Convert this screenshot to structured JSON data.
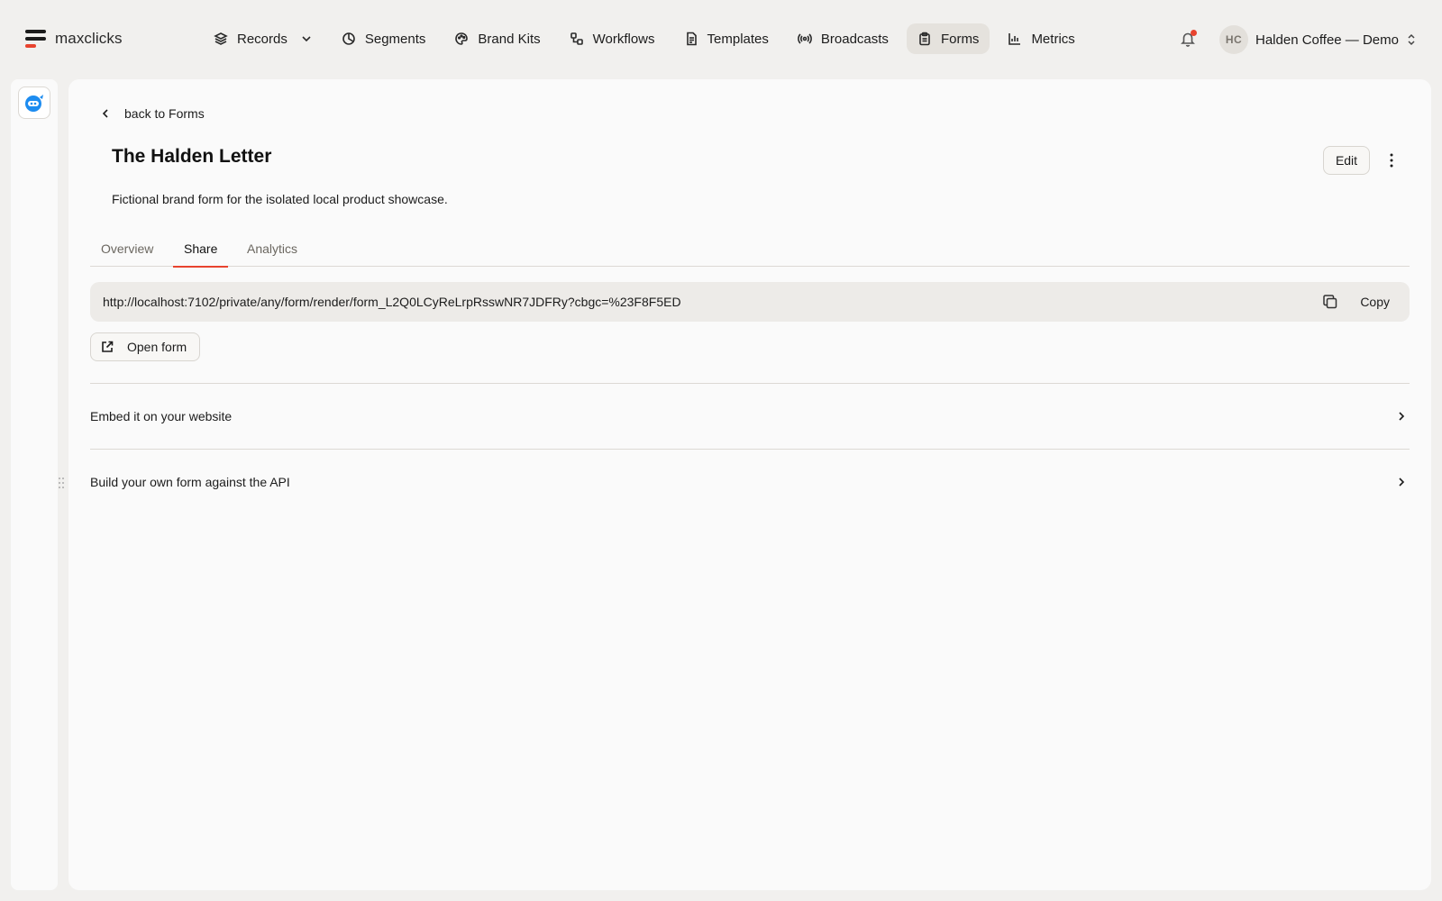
{
  "brand": {
    "name": "maxclicks",
    "accent": "#e8432e"
  },
  "nav": {
    "items": [
      {
        "label": "Records",
        "icon": "layers-icon"
      },
      {
        "label": "Segments",
        "icon": "pie-icon"
      },
      {
        "label": "Brand Kits",
        "icon": "palette-icon"
      },
      {
        "label": "Workflows",
        "icon": "workflow-icon"
      },
      {
        "label": "Templates",
        "icon": "document-icon"
      },
      {
        "label": "Broadcasts",
        "icon": "broadcast-icon"
      },
      {
        "label": "Forms",
        "icon": "clipboard-icon",
        "active": true
      },
      {
        "label": "Metrics",
        "icon": "bar-chart-icon"
      }
    ]
  },
  "account": {
    "initials": "HC",
    "name": "Halden Coffee — Demo"
  },
  "page": {
    "back_label": "back to Forms",
    "title": "The Halden Letter",
    "description": "Fictional brand form for the isolated local product showcase.",
    "edit_label": "Edit",
    "tabs": [
      {
        "label": "Overview"
      },
      {
        "label": "Share",
        "active": true
      },
      {
        "label": "Analytics"
      }
    ]
  },
  "share": {
    "url": "http://localhost:7102/private/any/form/render/form_L2Q0LCyReLrpRsswNR7JDFRy?cbgc=%23F8F5ED",
    "copy_label": "Copy",
    "open_label": "Open form",
    "sections": [
      {
        "label": "Embed it on your website"
      },
      {
        "label": "Build your own form against the API"
      }
    ]
  }
}
